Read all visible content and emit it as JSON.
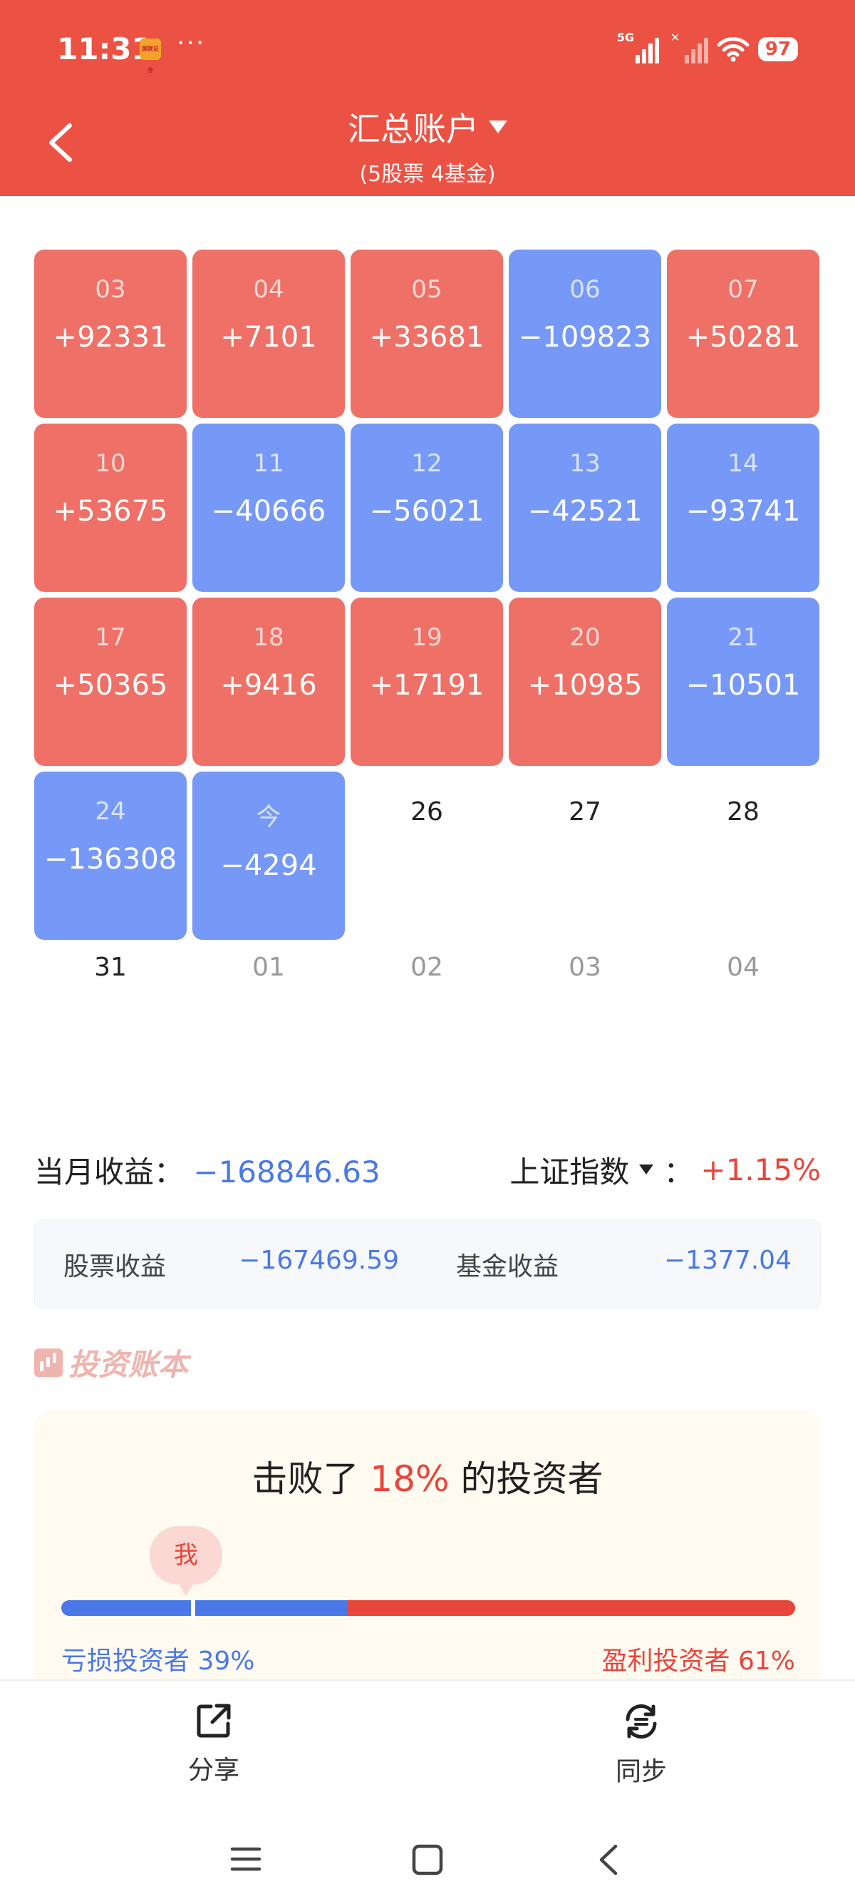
{
  "status": {
    "time": "11:31",
    "app_icon_text": "国联证券",
    "more": "···",
    "network_1": "5G",
    "battery": "97"
  },
  "header": {
    "title": "汇总账户",
    "subtitle": "(5股票 4基金)"
  },
  "calendar": [
    {
      "day": "03",
      "value": "+92331",
      "kind": "gain"
    },
    {
      "day": "04",
      "value": "+7101",
      "kind": "gain"
    },
    {
      "day": "05",
      "value": "+33681",
      "kind": "gain"
    },
    {
      "day": "06",
      "value": "−109823",
      "kind": "loss"
    },
    {
      "day": "07",
      "value": "+50281",
      "kind": "gain"
    },
    {
      "day": "10",
      "value": "+53675",
      "kind": "gain"
    },
    {
      "day": "11",
      "value": "−40666",
      "kind": "loss"
    },
    {
      "day": "12",
      "value": "−56021",
      "kind": "loss"
    },
    {
      "day": "13",
      "value": "−42521",
      "kind": "loss"
    },
    {
      "day": "14",
      "value": "−93741",
      "kind": "loss"
    },
    {
      "day": "17",
      "value": "+50365",
      "kind": "gain"
    },
    {
      "day": "18",
      "value": "+9416",
      "kind": "gain"
    },
    {
      "day": "19",
      "value": "+17191",
      "kind": "gain"
    },
    {
      "day": "20",
      "value": "+10985",
      "kind": "gain"
    },
    {
      "day": "21",
      "value": "−10501",
      "kind": "loss"
    },
    {
      "day": "24",
      "value": "−136308",
      "kind": "loss"
    },
    {
      "day": "今",
      "value": "−4294",
      "kind": "loss"
    },
    {
      "day": "26",
      "value": "",
      "kind": "blank"
    },
    {
      "day": "27",
      "value": "",
      "kind": "blank"
    },
    {
      "day": "28",
      "value": "",
      "kind": "blank"
    },
    {
      "day": "31",
      "value": "",
      "kind": "blank-last"
    },
    {
      "day": "01",
      "value": "",
      "kind": "future"
    },
    {
      "day": "02",
      "value": "",
      "kind": "future"
    },
    {
      "day": "03",
      "value": "",
      "kind": "future"
    },
    {
      "day": "04",
      "value": "",
      "kind": "future"
    }
  ],
  "summary": {
    "month_label": "当月收益：",
    "month_value": "−168846.63",
    "index_label": "上证指数",
    "index_sep": "：",
    "index_value": "+1.15%"
  },
  "breakdown": {
    "stock_label": "股票收益",
    "stock_value": "−167469.59",
    "fund_label": "基金收益",
    "fund_value": "−1377.04"
  },
  "brand": "投资账本",
  "beat": {
    "prefix": "击败了",
    "percent": "18%",
    "suffix": "的投资者",
    "me_label": "我",
    "beat_fraction": 0.18,
    "loss_fraction": 0.39,
    "loss_label": "亏损投资者 39%",
    "gain_label": "盈利投资者 61%"
  },
  "bottom_bar": {
    "share_label": "分享",
    "sync_label": "同步"
  },
  "colors": {
    "header": "#ec5244",
    "gain_cell": "#ef7066",
    "loss_cell": "#7699f7",
    "negative_text": "#4a78e6",
    "positive_text": "#e8453b"
  }
}
